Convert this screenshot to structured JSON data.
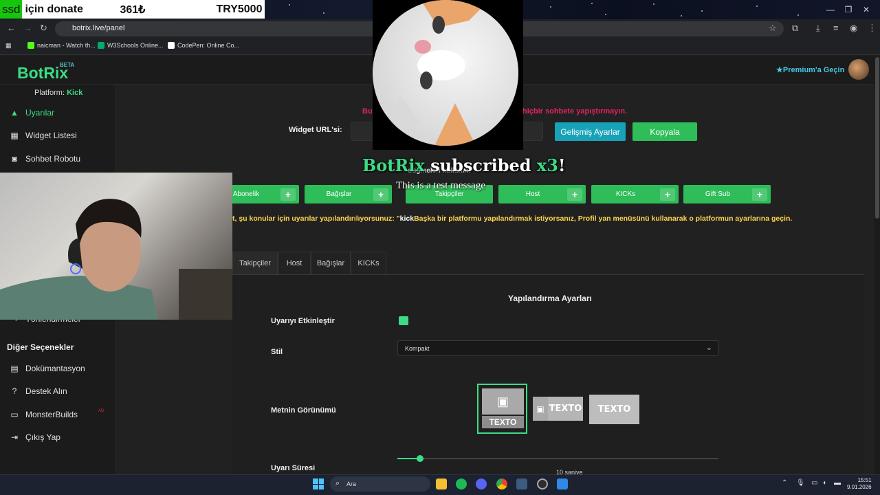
{
  "overlay": {
    "donate_prefix": "ssd",
    "donate_text": "için donate",
    "donate_amount": "361₺",
    "donate_goal": "TRY5000",
    "alert_brand": "BotRix",
    "alert_text": " subscribed ",
    "alert_count": "x3",
    "alert_end": "!",
    "alert_message": "This is a test message"
  },
  "window": {
    "minimize": "—",
    "maximize": "❐",
    "close": "✕"
  },
  "browser": {
    "url": "botrix.live/panel",
    "bookmarks": [
      "naicman - Watch th...",
      "W3Schools Online...",
      "CodePen: Online Co..."
    ]
  },
  "header": {
    "logo": "BotRix",
    "beta": "BETA",
    "premium": "Premium'a Geçin"
  },
  "sidebar": {
    "platform_label": "Platform:",
    "platform_value": "Kick",
    "items": [
      {
        "label": "Uyarılar",
        "icon": "warning-icon"
      },
      {
        "label": "Widget Listesi",
        "icon": "grid-icon"
      },
      {
        "label": "Sohbet Robotu",
        "icon": "robot-icon"
      },
      {
        "label": "Yönlendirmeler",
        "icon": "redirect-icon"
      }
    ],
    "section_title": "Diğer Seçenekler",
    "other_items": [
      {
        "label": "Dokümantasyon",
        "icon": "book-icon"
      },
      {
        "label": "Destek Alın",
        "icon": "help-icon"
      },
      {
        "label": "MonsterBuilds",
        "icon": "laptop-icon",
        "badge": "AD"
      },
      {
        "label": "Çıkış Yap",
        "icon": "logout-icon"
      }
    ]
  },
  "main": {
    "warning_left": "Bu",
    "warning_right": "hiçbir sohbete yapıştırmayın.",
    "widget_url_label": "Widget URL'si:",
    "advanced_button": "Gelişmiş Ayarlar",
    "copy_button": "Kopyala",
    "hint": "düğmeleri kullanın:",
    "test_buttons": [
      "Abonelik",
      "Bağışlar",
      "Takipçiler",
      "Host",
      "KICKs",
      "Gift Sub"
    ],
    "platform_note_start": "t, şu konular için uyarılar yapılandırılıyorsunuz: \"",
    "platform_note_kick": "kick",
    "platform_note_end": "Başka bir platformu yapılandırmak istiyorsanız, Profil yan menüsünü kullanarak o platformun ayarlarına geçin.",
    "tabs": [
      "Takipçiler",
      "Host",
      "Bağışlar",
      "KICKs"
    ],
    "config_title": "Yapılandırma Ayarları",
    "enable_label": "Uyarıyı Etkinleştir",
    "style_label": "Stil",
    "style_value": "Kompakt",
    "text_view_label": "Metnin Görünümü",
    "option_text": "TEXTO",
    "duration_label": "Uyarı Süresi",
    "duration_value": "10 saniye",
    "duration_fraction": 0.07
  },
  "taskbar": {
    "search": "Ara",
    "time": "15:51",
    "date": "9.01.2026"
  },
  "colors": {
    "accent": "#3ddc84",
    "button_green": "#2ebd59",
    "button_teal": "#17a2b8",
    "warning": "#e0245e",
    "note": "#ffd54f"
  }
}
